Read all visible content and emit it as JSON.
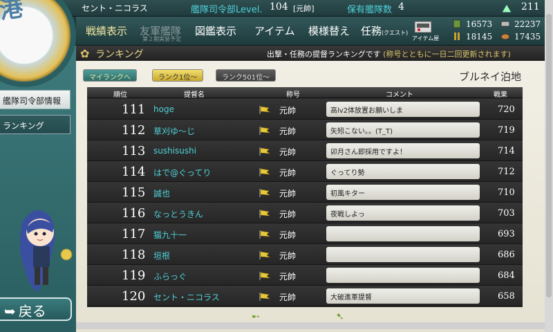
{
  "topbar": {
    "admiral_name": "セント・ニコラス",
    "hq_label": "艦隊司令部Level.",
    "hq_level": "104",
    "hq_rank": "[元帥]",
    "ships_label": "保有艦隊数",
    "ships_count": "4",
    "bucket_count": "211"
  },
  "nav": {
    "record": "戦績表示",
    "ally": "友軍艦隊",
    "ally_sub": "第２期実装予定",
    "library": "図鑑表示",
    "items": "アイテム",
    "furniture": "模様替え",
    "quest": "任務",
    "quest_small": "(クエスト)",
    "item_shop": "アイテム屋"
  },
  "resources": {
    "fuel": "16573",
    "steel": "22237",
    "ammo": "18145",
    "bauxite": "17435"
  },
  "sidebar": {
    "hq_info": "艦隊司令部情報",
    "ranking": "ランキング",
    "back": "戻る"
  },
  "page": {
    "title": "ランキング",
    "desc_main": "出撃・任務の提督ランキングです",
    "desc_note": "(称号とともに一日二回更新されます)",
    "server": "ブルネイ泊地"
  },
  "tabs": {
    "my_rank": "マイランクへ",
    "rank_1": "ランク1位～",
    "rank_501": "ランク501位～"
  },
  "table": {
    "headers": {
      "rank": "順位",
      "name": "提督名",
      "title": "称号",
      "comment": "コメント",
      "score": "戦果"
    },
    "rows": [
      {
        "rank": "111",
        "name": "hoge",
        "title": "元帥",
        "comment": "高lv2体放置お願いしま",
        "score": "720"
      },
      {
        "rank": "112",
        "name": "草刈ゆ～じ",
        "title": "元帥",
        "comment": "矢矧こない。。(T_T)",
        "score": "719"
      },
      {
        "rank": "113",
        "name": "sushisushi",
        "title": "元帥",
        "comment": "卯月さん即採用ですよ！",
        "score": "714"
      },
      {
        "rank": "114",
        "name": "はで@ぐってり",
        "title": "元帥",
        "comment": "ぐってり勢",
        "score": "712"
      },
      {
        "rank": "115",
        "name": "誠也",
        "title": "元帥",
        "comment": "初風キター",
        "score": "710"
      },
      {
        "rank": "116",
        "name": "なっとうきん",
        "title": "元帥",
        "comment": "夜戦しよっ",
        "score": "703"
      },
      {
        "rank": "117",
        "name": "猫九十一",
        "title": "元帥",
        "comment": "",
        "score": "693"
      },
      {
        "rank": "118",
        "name": "垣根",
        "title": "元帥",
        "comment": "",
        "score": "686"
      },
      {
        "rank": "119",
        "name": "ふらっぐ",
        "title": "元帥",
        "comment": "",
        "score": "684"
      },
      {
        "rank": "120",
        "name": "セント・ニコラス",
        "title": "元帥",
        "comment": "大破進軍提督",
        "score": "658"
      }
    ]
  },
  "colors": {
    "accent": "#4fd0d7",
    "gold": "#d9c46b",
    "active_tab": "#c9a82e"
  }
}
